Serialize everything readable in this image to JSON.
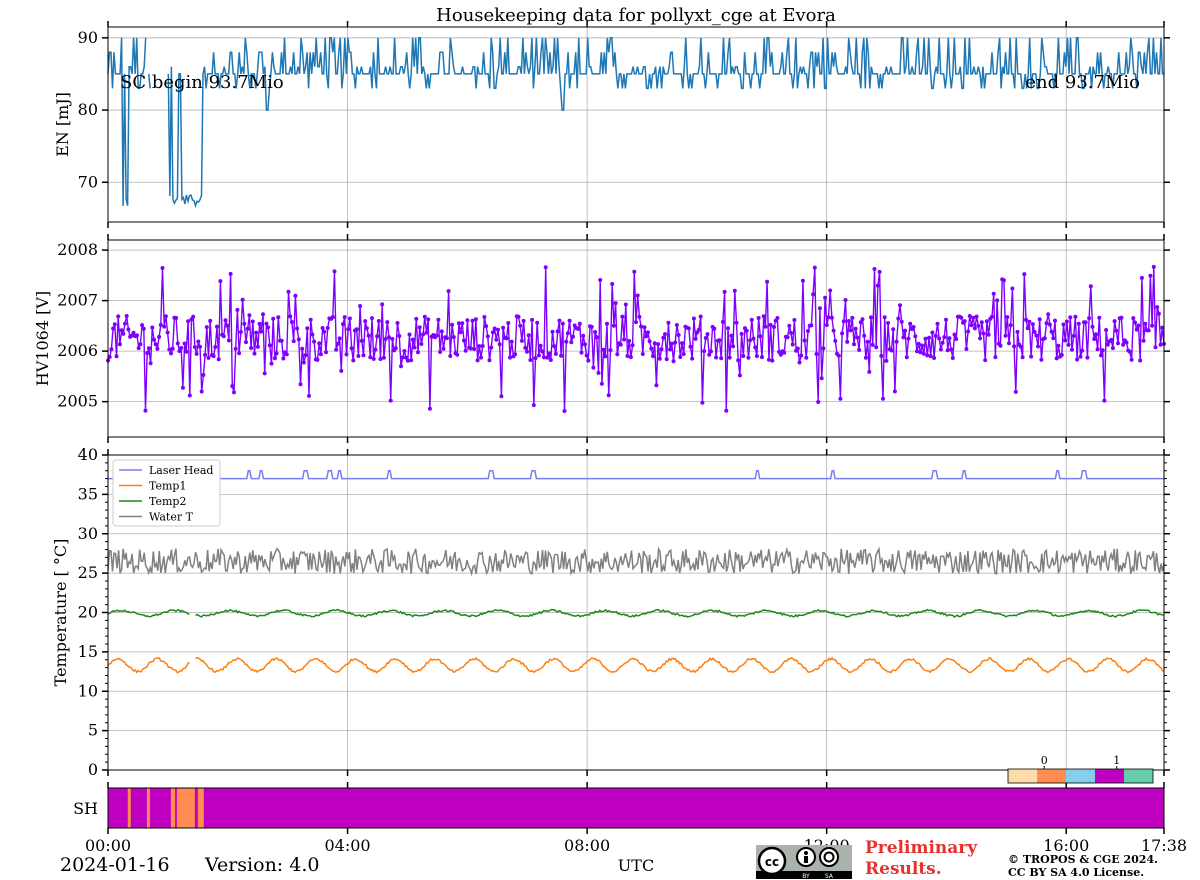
{
  "chart_data": [
    {
      "type": "line",
      "title": "Housekeeping data for pollyxt_cge at Evora",
      "ylabel": "EN [mJ]",
      "ylim": [
        64.5,
        91.5
      ],
      "yticks": [
        70,
        80,
        90
      ],
      "xlim": [
        0,
        17.633
      ],
      "annotations": {
        "left": "SC begin 93.7Mio",
        "right": "end 93.7Mio"
      },
      "series": [
        {
          "color": "#1f77b4",
          "baseline": 86.7,
          "noise": 1.8,
          "gaps": [
            [
              0.65,
              0.68
            ],
            [
              0.72,
              1.0
            ]
          ],
          "dips": [
            [
              0.25,
              0.35,
              66
            ],
            [
              1.02,
              1.58,
              66.5
            ]
          ],
          "spikes": [
            [
              2.65,
              80
            ],
            [
              7.6,
              80
            ]
          ]
        }
      ]
    },
    {
      "type": "line",
      "ylabel": "HV1064 [V]",
      "ylim": [
        2004.3,
        2008.2
      ],
      "yticks": [
        2005,
        2006,
        2007,
        2008
      ],
      "xlim": [
        0,
        17.633
      ],
      "series": [
        {
          "color": "#7f00ff",
          "marker": "dot",
          "baseline": 2006.25,
          "noise": 0.45,
          "min": 2004.5,
          "max": 2008.0
        }
      ]
    },
    {
      "type": "line",
      "ylabel": "Temperature [$^\\circ C$]",
      "ylim": [
        0,
        40
      ],
      "yticks": [
        0,
        5,
        10,
        15,
        20,
        25,
        30,
        35,
        40
      ],
      "xlim": [
        0,
        17.633
      ],
      "legend_position": "top-left",
      "series": [
        {
          "name": "Laser Head",
          "color": "#7b7bf2",
          "baseline": 37.0,
          "spikes": [
            2.35,
            2.55,
            3.3,
            3.7,
            3.87,
            4.7,
            6.4,
            7.1,
            10.85,
            12.1,
            13.8,
            14.3,
            15.85,
            16.3
          ]
        },
        {
          "name": "Temp1",
          "color": "#ff7f0e",
          "baseline": 13.3,
          "amplitude": 0.8,
          "min": 11.7,
          "max": 14.4,
          "gaps": [
            [
              1.38,
              1.45
            ]
          ]
        },
        {
          "name": "Temp2",
          "color": "#1a8a1a",
          "baseline": 19.9,
          "amplitude": 0.35,
          "min": 19.2,
          "max": 20.4,
          "gaps": [
            [
              1.38,
              1.45
            ]
          ]
        },
        {
          "name": "Water T",
          "color": "#808080",
          "baseline": 26.5,
          "amplitude": 1.6,
          "min": 24,
          "max": 29
        }
      ]
    },
    {
      "type": "heatmap",
      "ylabel": "SH",
      "xlim": [
        0,
        17.633
      ],
      "xtick_labels": [
        "00:00",
        "04:00",
        "08:00",
        "12:00",
        "16:00",
        "17:38"
      ],
      "xtick_values": [
        0,
        4,
        8,
        12,
        16,
        17.633
      ],
      "xlabel": "UTC",
      "base_color": "#c000c0",
      "segments": [
        {
          "start": 0.33,
          "end": 0.38,
          "color": "#ff8c50"
        },
        {
          "start": 0.65,
          "end": 0.7,
          "color": "#ff8c50"
        },
        {
          "start": 1.05,
          "end": 1.12,
          "color": "#ff8c50"
        },
        {
          "start": 1.15,
          "end": 1.45,
          "color": "#ff8c50"
        },
        {
          "start": 1.5,
          "end": 1.6,
          "color": "#ff8c50"
        }
      ],
      "colorbar": {
        "colors": [
          "#fddcaa",
          "#ff8c50",
          "#87ceeb",
          "#c000c0",
          "#66cdaa"
        ],
        "tick_labels": [
          "0",
          "1"
        ]
      }
    }
  ],
  "footer": {
    "date": "2024-01-16",
    "version": "Version: 4.0",
    "preliminary_line1": "Preliminary",
    "preliminary_line2": "Results.",
    "license_line1": "© TROPOS & CGE 2024.",
    "license_line2": "CC BY SA 4.0 License."
  }
}
